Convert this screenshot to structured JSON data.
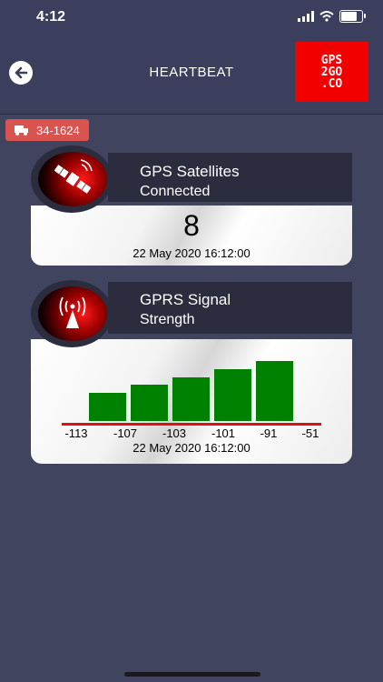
{
  "status_bar": {
    "time": "4:12",
    "battery_level": 0.7
  },
  "nav": {
    "back_icon": "back-arrow-icon",
    "title": "HEARTBEAT",
    "logo_text": [
      "GPS",
      "2GO",
      ".CO"
    ]
  },
  "vehicle": {
    "icon": "truck-icon",
    "label": "34-1624"
  },
  "gps_card": {
    "icon": "satellite-icon",
    "title": "GPS Satellites",
    "subtitle": "Connected",
    "value": "8",
    "timestamp": "22 May 2020 16:12:00"
  },
  "gprs_card": {
    "icon": "signal-tower-icon",
    "title": "GPRS Signal",
    "subtitle": "Strength",
    "timestamp": "22 May 2020 16:12:00",
    "chart_data": {
      "type": "bar",
      "tick_labels": [
        "-113",
        "-107",
        "-103",
        "-101",
        "-91",
        "-51"
      ],
      "bar_heights": [
        0.47,
        0.6,
        0.73,
        0.86,
        1.0
      ],
      "bar_color": "#008000",
      "baseline_color": "#e01010"
    }
  },
  "colors": {
    "background": "#41445f",
    "nav": "#3b3e5c",
    "header": "#2b2d3e",
    "badge": "#d9534f",
    "logo": "#f20000"
  }
}
